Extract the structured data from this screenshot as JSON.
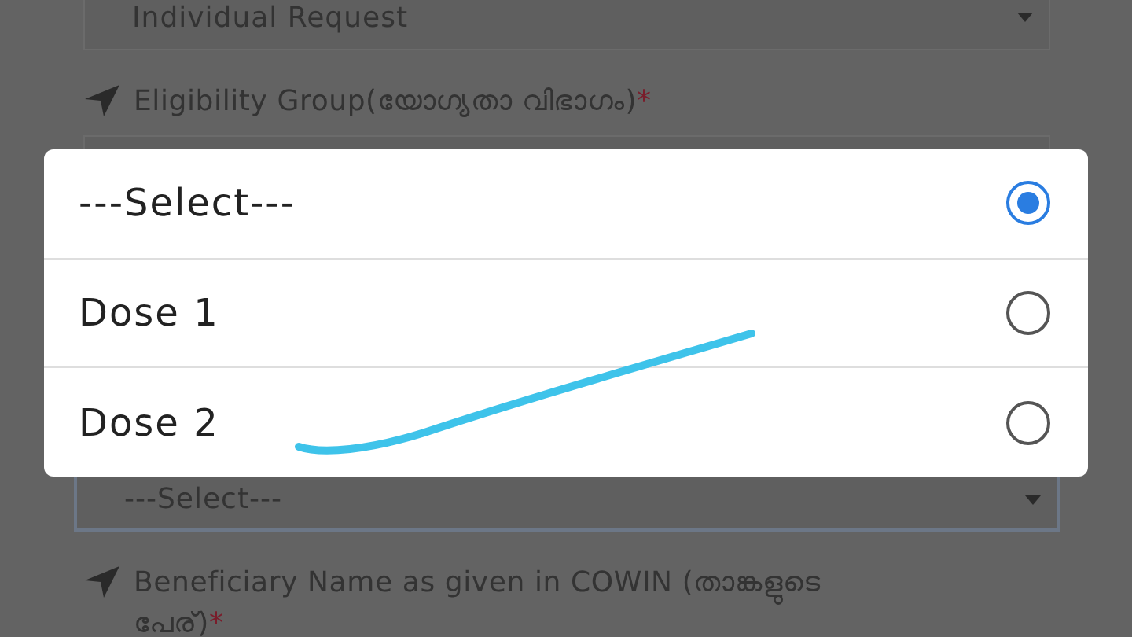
{
  "form": {
    "items": [
      {
        "kind": "select",
        "value": "Individual Request",
        "focused": false
      },
      {
        "kind": "label",
        "text": "Eligibility Group(യോഗ്യതാ വിഭാഗം)",
        "required_mark": "*"
      },
      {
        "kind": "select",
        "focused": false
      },
      {
        "kind": "spacer"
      },
      {
        "kind": "select",
        "value": "---Select---",
        "focused": true
      },
      {
        "kind": "label",
        "text": "Beneficiary Name as given in COWIN (താങ്കളുടെ പേര്)",
        "required_mark": "*"
      }
    ]
  },
  "dialog": {
    "options": [
      {
        "label": "---Select---",
        "selected": true
      },
      {
        "label": "Dose 1",
        "selected": false
      },
      {
        "label": "Dose 2",
        "selected": false
      }
    ]
  }
}
